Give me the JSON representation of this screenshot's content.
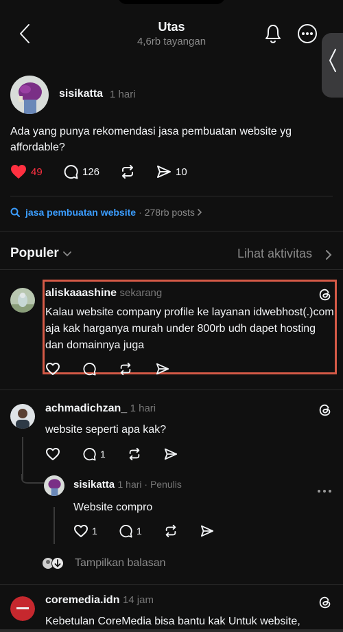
{
  "header": {
    "title": "Utas",
    "subtitle": "4,6rb tayangan"
  },
  "post": {
    "author": "sisikatta",
    "time": "1 hari",
    "text": "Ada yang punya rekomendasi jasa pembuatan website yg affordable?",
    "likes": "49",
    "replies": "126",
    "shares": "10"
  },
  "tag": {
    "name": "jasa pembuatan website",
    "count": "278rb posts"
  },
  "sort": {
    "label": "Populer",
    "activity": "Lihat aktivitas"
  },
  "replies": [
    {
      "author": "aliskaaashine",
      "time": "sekarang",
      "text": "Kalau website company profile ke layanan idwebhost(.)com aja kak harganya murah under 800rb udh dapet hosting dan domainnya juga"
    },
    {
      "author": "achmadichzan_",
      "time": "1 hari",
      "text": "website seperti apa kak?",
      "replies": "1"
    },
    {
      "author": "sisikatta",
      "time": "1 hari · Penulis",
      "text": "Website compro",
      "likes": "1",
      "replies": "1"
    },
    {
      "author": "coremedia.idn",
      "time": "14 jam",
      "text": "Kebetulan CoreMedia bisa bantu kak Untuk website,"
    }
  ],
  "show_replies": "Tampilkan balasan",
  "colors": {
    "background": "#101010",
    "like": "#ff3040",
    "link": "#3b9dff",
    "highlight": "#d55a47"
  }
}
